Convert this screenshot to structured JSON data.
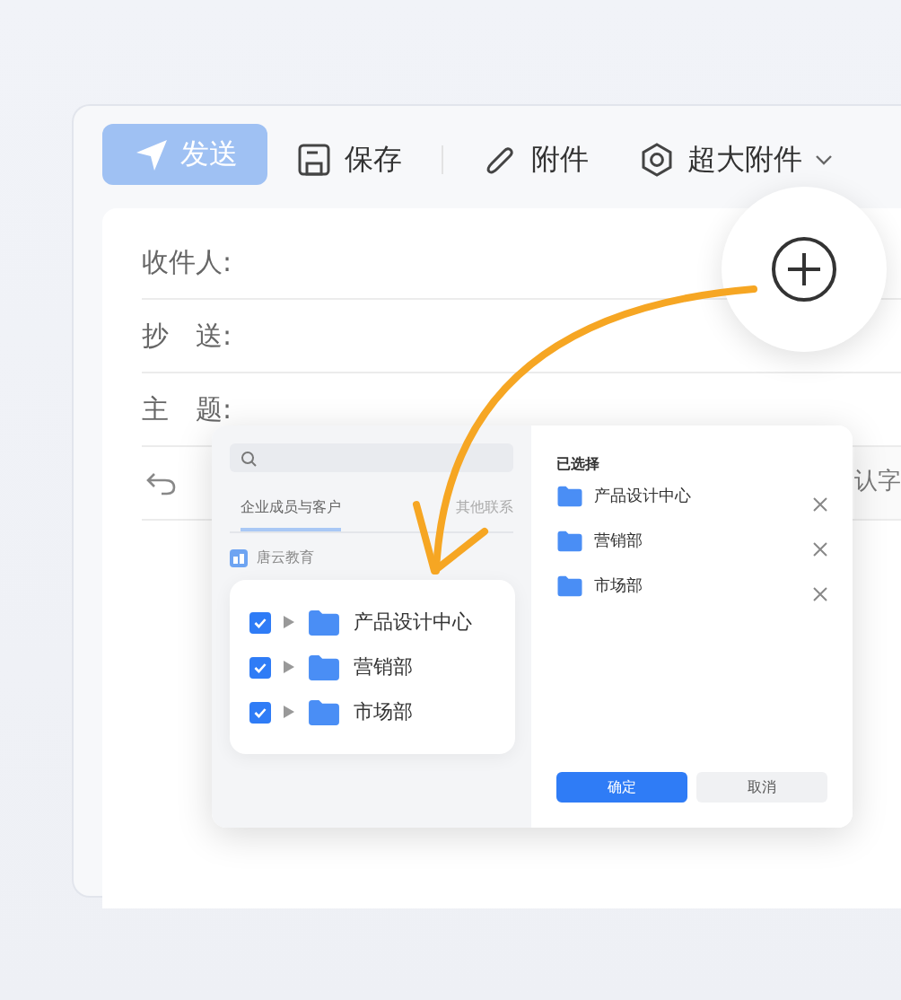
{
  "toolbar": [
    {
      "kind": "send",
      "label": "发送",
      "disabled": true
    },
    {
      "kind": "save",
      "label": "保存",
      "disabled": false
    },
    {
      "kind": "attach",
      "label": "附件",
      "disabled": false
    },
    {
      "kind": "large",
      "label": "超大附件",
      "disabled": false
    }
  ],
  "compose": {
    "fields": [
      {
        "label": "收件人:"
      },
      {
        "label": "抄　送:"
      },
      {
        "label": "主　题:"
      }
    ],
    "font_label": "认字"
  },
  "dialog": {
    "tabs": [
      {
        "label": "企业成员与客户",
        "selected": true
      },
      {
        "label": "其他联系",
        "selected": false
      }
    ],
    "org": "唐云教育",
    "departments": [
      {
        "name": "产品设计中心",
        "checked": true
      },
      {
        "name": "营销部",
        "checked": true
      },
      {
        "name": "市场部",
        "checked": true
      }
    ],
    "selected_title": "已选择",
    "selected_items": [
      {
        "name": "产品设计中心"
      },
      {
        "name": "营销部"
      },
      {
        "name": "市场部"
      }
    ],
    "buttons": [
      {
        "kind": "primary",
        "label": "确定"
      },
      {
        "kind": "secondary",
        "label": "取消"
      }
    ]
  }
}
